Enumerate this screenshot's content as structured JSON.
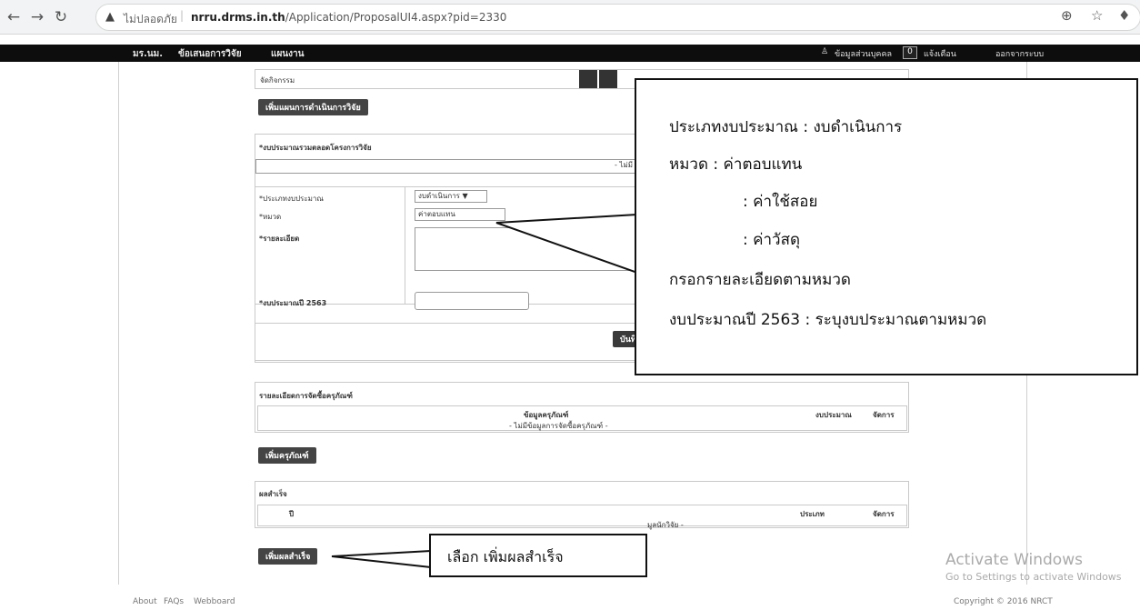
{
  "browser": {
    "insecure_label": "ไม่ปลอดภัย",
    "url_domain": "nrru.drms.in.th",
    "url_path": "/Application/ProposalUI4.aspx?pid=2330"
  },
  "nav": {
    "items": [
      "มร.นม.",
      "ข้อเสนอการวิจัย",
      "แผนงาน"
    ],
    "profile": "ข้อมูลส่วนบุคคล",
    "notify_count": "0",
    "notify": "แจ้งเตือน",
    "logout": "ออกจากระบบ"
  },
  "form": {
    "top_row": "จัดกิจกรรม",
    "add_plan_btn": "เพิ่มแผนการดำเนินการวิจัย",
    "budget_total_label": "*งบประมาณรวมตลอดโครงการวิจัย",
    "budget_total_value": "- ไม่มี",
    "type_label": "*ประเภทงบประมาณ",
    "type_value": "งบดำเนินการ ▼",
    "category_label": "*หมวด",
    "category_value": "ค่าตอบแทน",
    "detail_label": "*รายละเอียด",
    "year_label": "*งบประมาณปี 2563",
    "save_btn": "บันทึ"
  },
  "equipment": {
    "title": "รายละเอียดการจัดซื้อครุภัณฑ์",
    "columns": [
      "ข้อมูลครุภัณฑ์",
      "งบประมาณ",
      "จัดการ"
    ],
    "empty": "- ไม่มีข้อมูลการจัดซื้อครุภัณฑ์ -",
    "add_btn": "เพิ่มครุภัณฑ์"
  },
  "achievement": {
    "title": "ผลสำเร็จ",
    "columns": [
      "ปี",
      "ประเภท",
      "จัดการ"
    ],
    "empty": "มูลนักวิจัย -",
    "add_btn": "เพิ่มผลสำเร็จ"
  },
  "callout_main": {
    "lines": [
      "ประเภทงบประมาณ : งบดำเนินการ",
      "หมวด    : ค่าตอบแทน",
      ": ค่าใช้สอย",
      ": ค่าวัสดุ",
      "กรอกรายละเอียดตามหมวด",
      "งบประมาณปี 2563 : ระบุงบประมาณตามหมวด"
    ]
  },
  "callout_small": {
    "text": "เลือก เพิ่มผลสำเร็จ"
  },
  "footer": {
    "links": [
      "About",
      "FAQs",
      "Webboard"
    ],
    "copyright": "Copyright © 2016 NRCT"
  },
  "watermark": {
    "line1": "Activate Windows",
    "line2": "Go to Settings to activate Windows"
  }
}
